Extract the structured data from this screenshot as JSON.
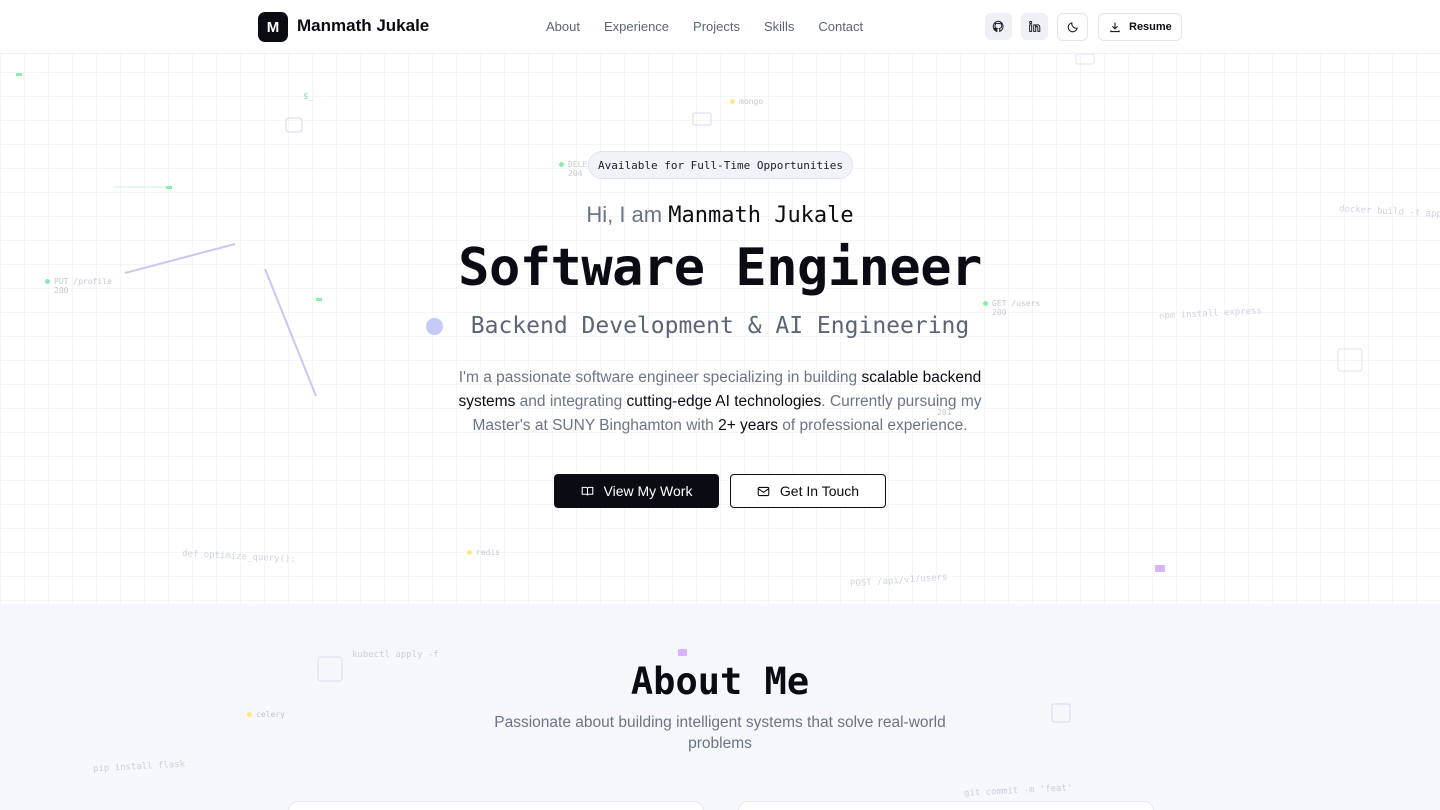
{
  "header": {
    "logo_letter": "M",
    "logo_name": "Manmath Jukale",
    "nav": [
      "About",
      "Experience",
      "Projects",
      "Skills",
      "Contact"
    ],
    "resume_label": "Resume",
    "icons": [
      "github-icon",
      "linkedin-icon",
      "moon-icon",
      "download-icon"
    ]
  },
  "hero": {
    "badge": "Available for Full-Time Opportunities",
    "greeting": "Hi, I am",
    "name": "Manmath Jukale",
    "title": "Software Engineer",
    "subtitle": "Backend Development & AI Engineering",
    "description": {
      "p1": "I'm a passionate software engineer specializing in building ",
      "h1": "scalable backend systems",
      "p2": " and integrating ",
      "h2": "cutting-edge AI technologies",
      "p3": ". Currently pursuing my Master's at SUNY Binghamton with ",
      "h3": "2+ years",
      "p4": " of professional experience."
    },
    "primary_button": "View My Work",
    "secondary_button": "Get In Touch"
  },
  "about": {
    "title": "About Me",
    "subtitle": "Passionate about building intelligent systems that solve real-world problems"
  },
  "decorations": {
    "put_profile": "PUT /profile",
    "put_status": "200",
    "delete_label": "DELE",
    "delete_status": "204",
    "get_users": "GET /users",
    "get_status": "200",
    "status_201": "201",
    "def_query": "def optimize_query():",
    "post_api": "POST /api/v1/users",
    "kubectl": "kubectl apply -f",
    "pip": "pip install flask",
    "git": "git commit -m 'feat'",
    "npm": "npm install express",
    "docker": "docker build -t app",
    "dollar": "$_",
    "redis": "redis",
    "celery": "celery",
    "mongo": "mongo"
  },
  "colors": {
    "ink": "#0b0b14",
    "muted": "#6b7386",
    "accent_dot": "#c5c9f5",
    "api_green": "#4ade80",
    "api_yellow": "#facc15"
  }
}
